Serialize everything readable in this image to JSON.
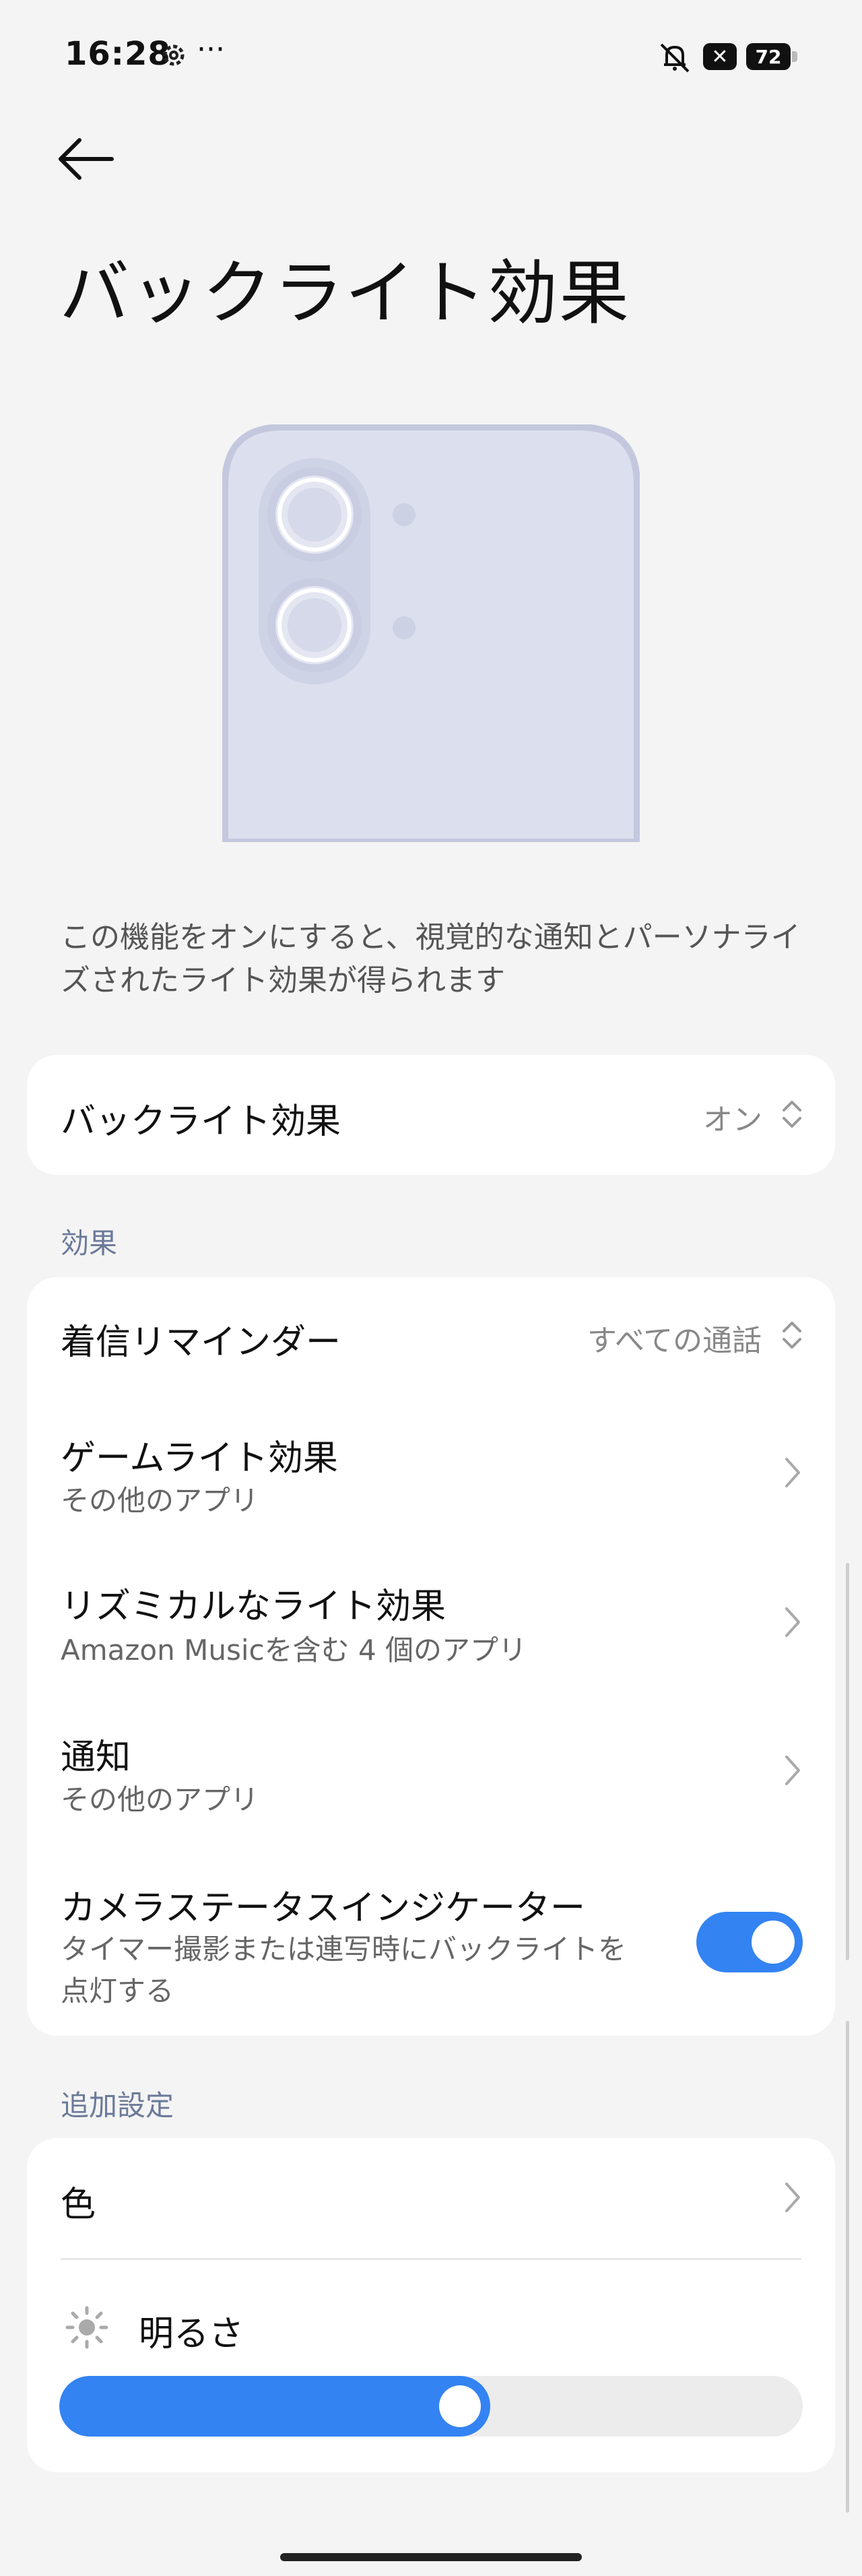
{
  "status_bar": {
    "time": "16:28",
    "more": "···",
    "notification_icon": "✕",
    "battery": "72"
  },
  "page": {
    "title": "バックライト効果",
    "description": "この機能をオンにすると、視覚的な通知とパーソナライズされたライト効果が得られます"
  },
  "main_setting": {
    "label": "バックライト効果",
    "value": "オン"
  },
  "effects_section": {
    "header": "効果",
    "items": [
      {
        "title": "着信リマインダー",
        "value": "すべての通話"
      },
      {
        "title": "ゲームライト効果",
        "subtitle": "その他のアプリ"
      },
      {
        "title": "リズミカルなライト効果",
        "subtitle": "Amazon Musicを含む 4 個のアプリ"
      },
      {
        "title": "通知",
        "subtitle": "その他のアプリ"
      },
      {
        "title": "カメラステータスインジケーター",
        "subtitle_line1": "タイマー撮影または連写時にバックライトを",
        "subtitle_line2": "点灯する",
        "enabled": true
      }
    ]
  },
  "additional_section": {
    "header": "追加設定",
    "color_label": "色",
    "brightness_label": "明るさ",
    "brightness_level": 0.58
  },
  "colors": {
    "accent": "#3383f2",
    "background": "#f4f4f4",
    "card": "#ffffff",
    "section_header": "#6b7a99"
  },
  "icons": {
    "back": "arrow-left-icon",
    "settings": "gear-icon",
    "mute": "bell-off-icon",
    "chevron": "chevron-right-icon",
    "updown": "chevron-updown-icon",
    "brightness": "sun-icon"
  }
}
